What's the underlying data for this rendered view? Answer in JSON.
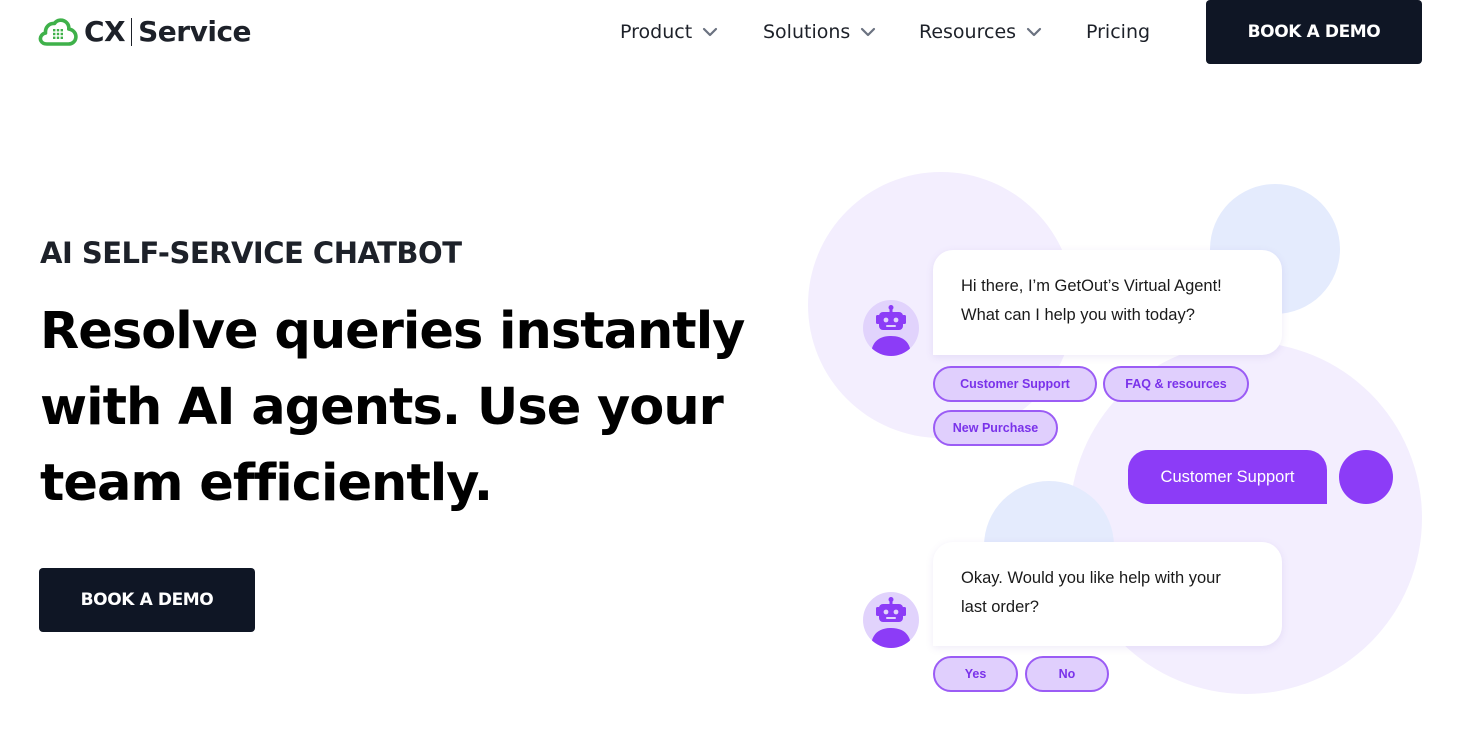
{
  "header": {
    "logo": {
      "left": "CX",
      "right": "Service",
      "icon": "cloud-grid-icon"
    },
    "nav": [
      {
        "label": "Product",
        "has_dropdown": true
      },
      {
        "label": "Solutions",
        "has_dropdown": true
      },
      {
        "label": "Resources",
        "has_dropdown": true
      },
      {
        "label": "Pricing",
        "has_dropdown": false
      }
    ],
    "cta_label": "BOOK A DEMO"
  },
  "hero": {
    "eyebrow": "AI SELF-SERVICE CHATBOT",
    "headline_lines": [
      "Resolve queries instantly",
      "with AI agents. Use your",
      "team efficiently."
    ],
    "cta_label": "BOOK A DEMO"
  },
  "chat": {
    "bot_message_1": {
      "lines": [
        "Hi there, I’m GetOut’s Virtual Agent!",
        "What can I help you with today?"
      ],
      "options": [
        "Customer Support",
        "FAQ & resources",
        "New Purchase"
      ]
    },
    "user_reply": "Customer Support",
    "bot_message_2": {
      "lines": [
        "Okay. Would you like help with your",
        "last order?"
      ],
      "options": [
        "Yes",
        "No"
      ]
    }
  },
  "colors": {
    "brand_green": "#3fb14a",
    "dark_button": "#0f1625",
    "accent_purple": "#8c3cf7",
    "chip_fill": "#e0cffd",
    "chip_border": "#9b5cf5",
    "bg_lavender": "#f3eefe",
    "bg_blue": "#e4ebfd"
  }
}
